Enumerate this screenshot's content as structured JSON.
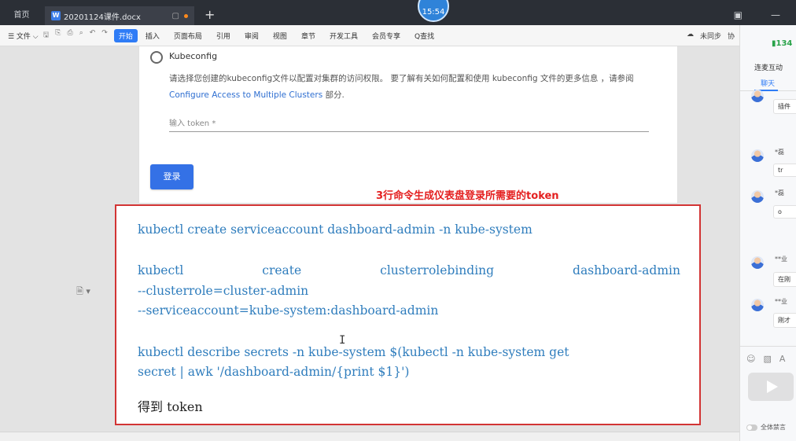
{
  "titlebar": {
    "home_tab": "首页",
    "doc_tab": "20201124课件.docx",
    "doc_icon": "W",
    "clock": "15:54"
  },
  "toolbar": {
    "file_menu": "☰ 文件 ⌵",
    "start_tab": "开始",
    "menu_items": [
      "插入",
      "页面布局",
      "引用",
      "审阅",
      "视图",
      "章节",
      "开发工具",
      "会员专享",
      "Q查找"
    ],
    "sync_status": "未同步",
    "collab": "协"
  },
  "document": {
    "kubeconfig_label": "Kubeconfig",
    "kubeconfig_desc_pre": "请选择您创建的kubeconfig文件以配置对集群的访问权限。 要了解有关如何配置和使用 kubeconfig 文件的更多信息 ，请参阅",
    "kubeconfig_link": "Configure Access to Multiple Clusters",
    "kubeconfig_desc_post": " 部分.",
    "token_placeholder": "输入 token *",
    "login_button": "登录",
    "annotation_title": "3行命令生成仪表盘登录所需要的token",
    "cmd1": "kubectl create serviceaccount dashboard-admin -n kube-system",
    "cmd2_words": [
      "kubectl",
      "create",
      "clusterrolebinding",
      "dashboard-admin"
    ],
    "cmd2_line2": "--clusterrole=cluster-admin",
    "cmd2_line3": "--serviceaccount=kube-system:dashboard-admin",
    "cmd3_line1": "kubectl describe secrets -n kube-system $(kubectl -n kube-system get",
    "cmd3_line2": "secret | awk '/dashboard-admin/{print $1}')",
    "result": "得到 token"
  },
  "panel": {
    "signal": "134",
    "title": "连麦互动",
    "tab": "聊天",
    "messages": [
      {
        "name": "",
        "text": "插件"
      },
      {
        "name": "*磊",
        "text": "tr"
      },
      {
        "name": "*磊",
        "text": "o"
      },
      {
        "name": "**业",
        "text": "在刚"
      },
      {
        "name": "**业",
        "text": "刚才"
      }
    ],
    "mute_label": "全体禁言"
  }
}
